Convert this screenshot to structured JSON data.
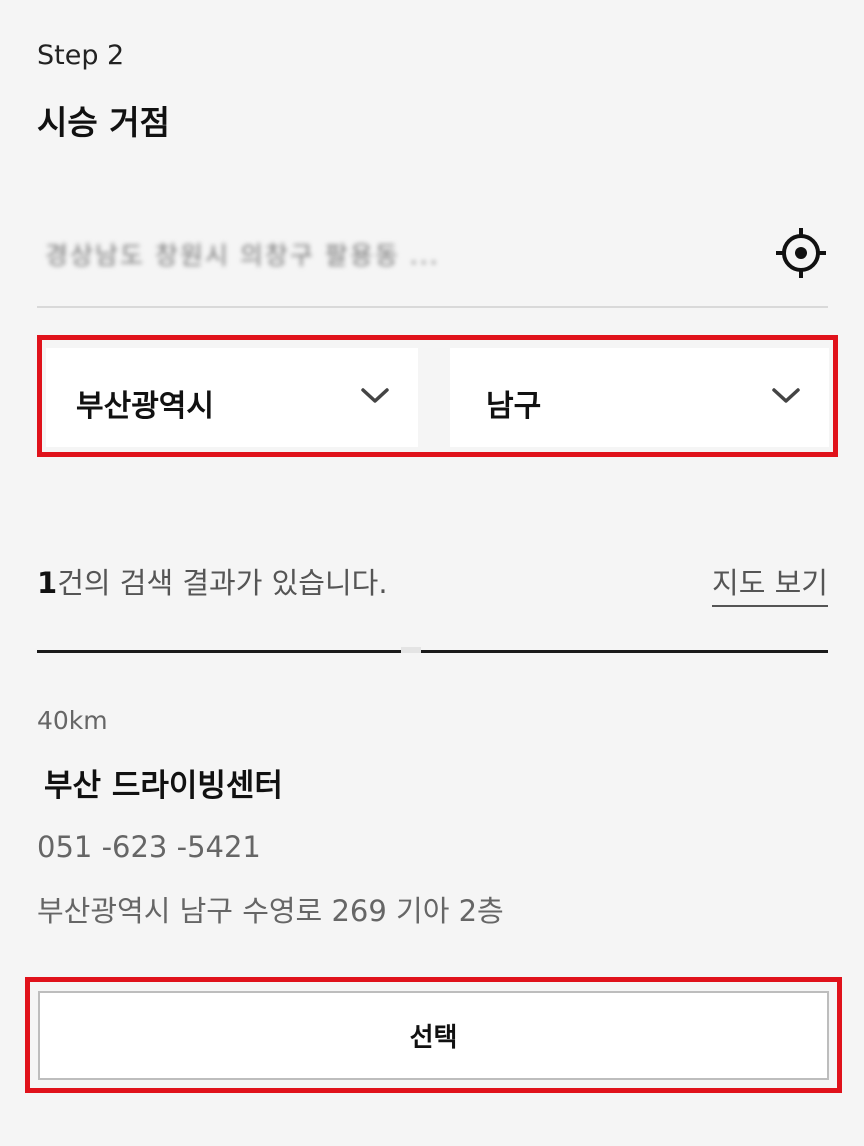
{
  "step": {
    "label": "Step 2"
  },
  "title": "시승 거점",
  "location": {
    "blurred_address": "경상남도 창원시 의창구 팔용동 ...",
    "locate_icon": "crosshair-target-icon"
  },
  "region": {
    "city": "부산광역시",
    "district": "남구",
    "dropdown_icon": "chevron-down-icon"
  },
  "results": {
    "count": "1",
    "count_suffix": "건의 검색 결과가 있습니다.",
    "map_link": "지도 보기"
  },
  "center": {
    "distance": "40km",
    "name": "부산 드라이빙센터",
    "phone": "051 -623 -5421",
    "address": "부산광역시 남구 수영로 269 기아 2층"
  },
  "actions": {
    "select_label": "선택"
  },
  "colors": {
    "highlight": "#e0121b",
    "background": "#f5f5f5"
  }
}
